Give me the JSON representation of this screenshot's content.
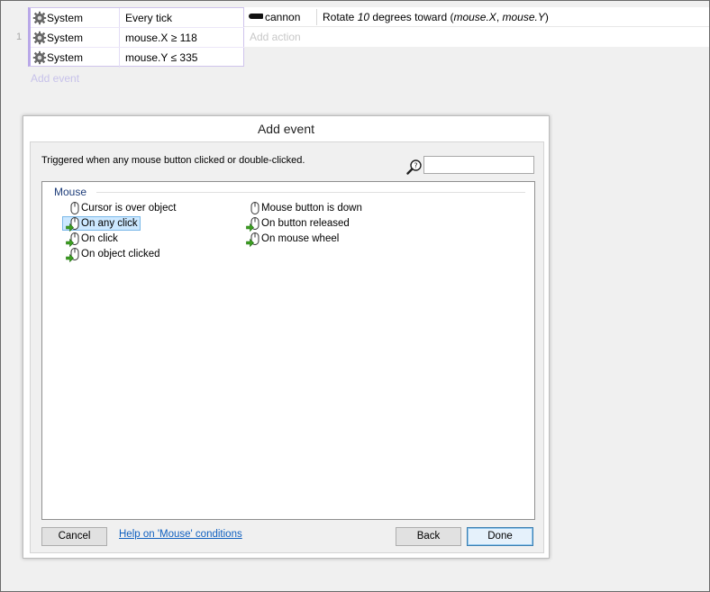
{
  "event_sheet": {
    "line_number": "1",
    "conditions": [
      {
        "object": "System",
        "text": "Every tick"
      },
      {
        "object": "System",
        "text": "mouse.X ≥ 118"
      },
      {
        "object": "System",
        "text": "mouse.Y ≤ 335"
      }
    ],
    "action": {
      "object": "cannon",
      "text_prefix": "Rotate ",
      "text_amount": "10",
      "text_middle": " degrees toward (",
      "text_arg1": "mouse.X",
      "text_comma": ", ",
      "text_arg2": "mouse.Y",
      "text_suffix": ")"
    },
    "add_action_label": "Add action",
    "add_event_label": "Add event"
  },
  "dialog": {
    "title": "Add event",
    "description": "Triggered when any mouse button clicked or double-clicked.",
    "search_value": "",
    "category": "Mouse",
    "items_left": [
      {
        "label": "Cursor is over object",
        "icon": "mouse-icon",
        "trigger": false
      },
      {
        "label": "On any click",
        "icon": "mouse-trigger-icon",
        "trigger": true,
        "selected": true
      },
      {
        "label": "On click",
        "icon": "mouse-trigger-icon",
        "trigger": true
      },
      {
        "label": "On object clicked",
        "icon": "mouse-trigger-icon",
        "trigger": true
      }
    ],
    "items_right": [
      {
        "label": "Mouse button is down",
        "icon": "mouse-icon",
        "trigger": false
      },
      {
        "label": "On button released",
        "icon": "mouse-trigger-icon",
        "trigger": true
      },
      {
        "label": "On mouse wheel",
        "icon": "mouse-trigger-icon",
        "trigger": true
      }
    ],
    "buttons": {
      "cancel": "Cancel",
      "help": "Help on 'Mouse' conditions",
      "back": "Back",
      "done": "Done"
    }
  },
  "colors": {
    "selection_bg": "#cce8ff",
    "selection_border": "#7ab8e8",
    "link": "#1060c0",
    "category_title": "#1e3d7a",
    "condition_block_border": "#b9a8e8"
  }
}
